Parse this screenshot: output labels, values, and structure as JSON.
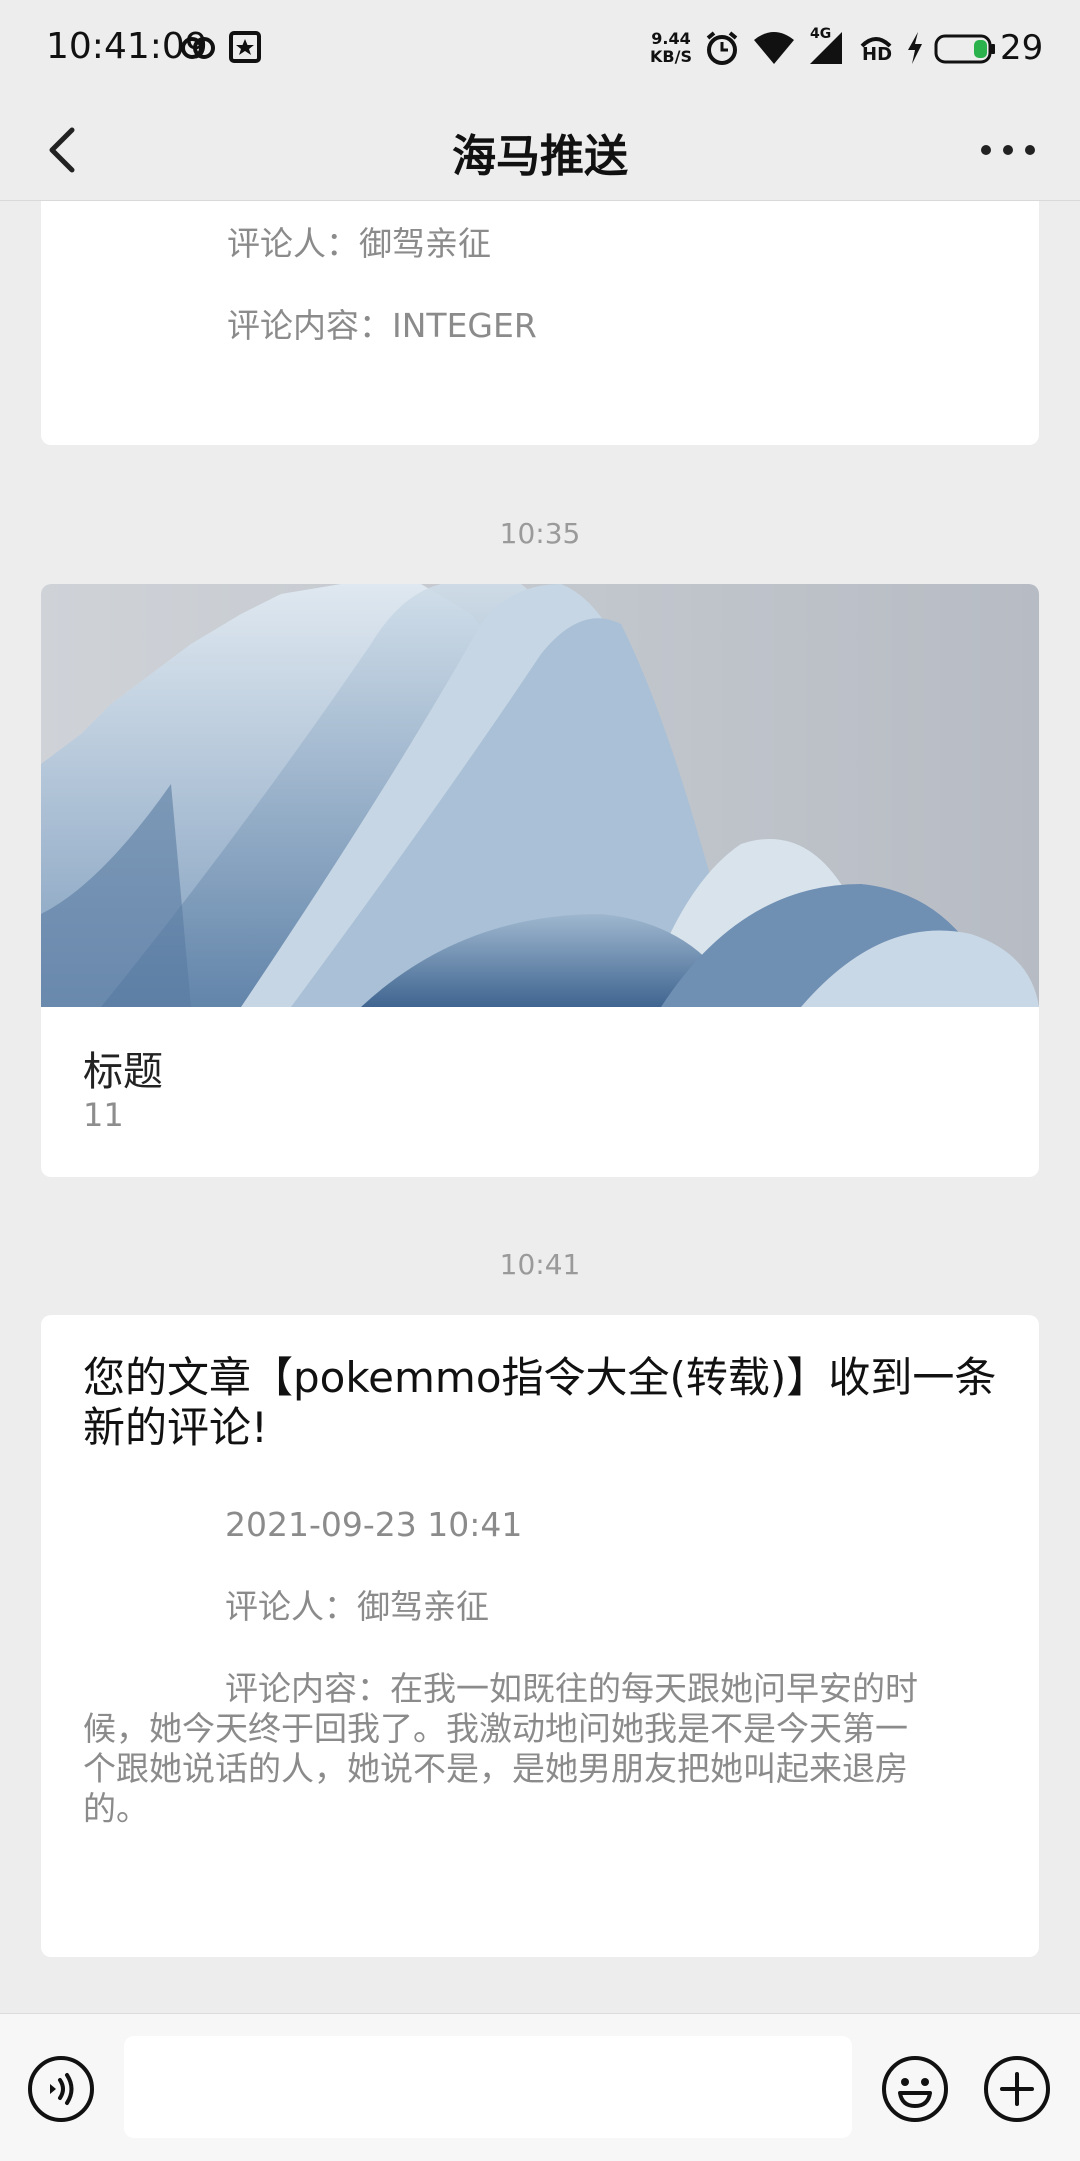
{
  "status_bar": {
    "time": "10:41:09",
    "net_speed_value": "9.44",
    "net_speed_unit": "KB/S",
    "network_label": "4G",
    "hd_label": "HD",
    "battery_level": "29",
    "battery_color": "#2bb24c"
  },
  "nav": {
    "title": "海马推送"
  },
  "messages": {
    "card1": {
      "commenter": "评论人：御驾亲征",
      "content": "评论内容：INTEGER"
    },
    "time2": "10:35",
    "card2": {
      "title": "标题",
      "description": "11"
    },
    "time3": "10:41",
    "card3": {
      "title": "您的文章【pokemmo指令大全(转载)】收到一条新的评论!",
      "date": "2021-09-23  10:41",
      "commenter": "评论人：御驾亲征",
      "content_line1": "评论内容：在我一如既往的每天跟她问早安的时",
      "content_line2": "候，她今天终于回我了。我激动地问她我是不是今天第一",
      "content_line3": "个跟她说话的人，她说不是，是她男朋友把她叫起来退房",
      "content_line4": "的。"
    }
  },
  "input_bar": {
    "value": "",
    "voice_icon": "voice-icon",
    "emoji_icon": "emoji-icon",
    "plus_icon": "plus-icon"
  }
}
